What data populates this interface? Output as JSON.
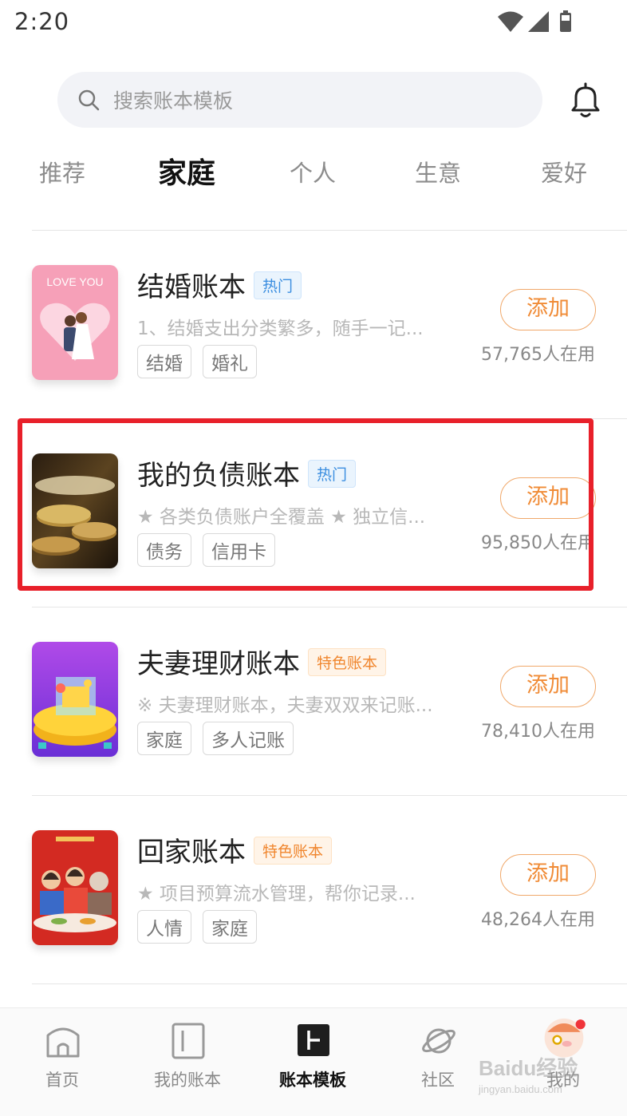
{
  "status_bar": {
    "time": "2:20"
  },
  "search": {
    "placeholder": "搜索账本模板"
  },
  "tabs": [
    {
      "label": "推荐"
    },
    {
      "label": "家庭"
    },
    {
      "label": "个人"
    },
    {
      "label": "生意"
    },
    {
      "label": "爱好"
    }
  ],
  "active_tab": "家庭",
  "cards": [
    {
      "title": "结婚账本",
      "badge": "热门",
      "desc": "1、结婚支出分类繁多，随手一记...",
      "tags": [
        "结婚",
        "婚礼"
      ],
      "add": "添加",
      "users": "57,765人在用",
      "thumb_text": "LOVE YOU"
    },
    {
      "title": "我的负债账本",
      "badge": "热门",
      "desc": "★ 各类负债账户全覆盖 ★ 独立信...",
      "tags": [
        "债务",
        "信用卡"
      ],
      "add": "添加",
      "users": "95,850人在用"
    },
    {
      "title": "夫妻理财账本",
      "badge": "特色账本",
      "desc": "※ 夫妻理财账本，夫妻双双来记账...",
      "tags": [
        "家庭",
        "多人记账"
      ],
      "add": "添加",
      "users": "78,410人在用"
    },
    {
      "title": "回家账本",
      "badge": "特色账本",
      "desc": "★ 项目预算流水管理，帮你记录...",
      "tags": [
        "人情",
        "家庭"
      ],
      "add": "添加",
      "users": "48,264人在用"
    }
  ],
  "bottom_nav": [
    {
      "label": "首页",
      "icon": "home-icon"
    },
    {
      "label": "我的账本",
      "icon": "book-icon"
    },
    {
      "label": "账本模板",
      "icon": "template-icon"
    },
    {
      "label": "社区",
      "icon": "planet-icon"
    },
    {
      "label": "我的",
      "icon": "avatar-icon"
    }
  ],
  "watermark": {
    "main": "Baidu经验",
    "sub": "jingyan.baidu.com"
  },
  "colors": {
    "accent": "#f08b36",
    "hot_badge": "#3b8ee0",
    "highlight": "#e8202a"
  }
}
